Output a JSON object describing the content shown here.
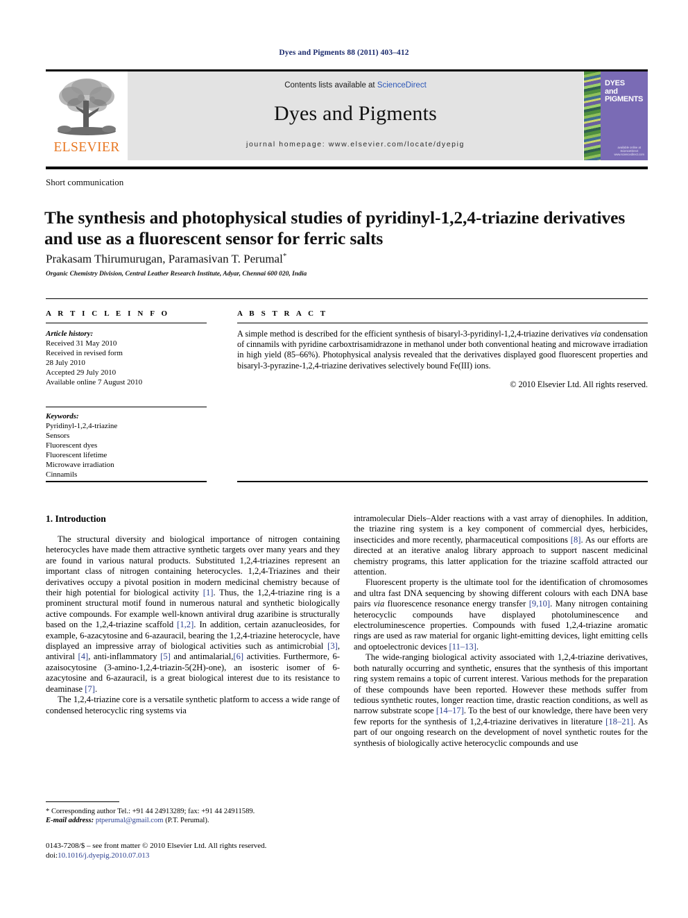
{
  "running_head": "Dyes and Pigments 88 (2011) 403–412",
  "masthead": {
    "publisher_name": "ELSEVIER",
    "contents_prefix": "Contents lists available at ",
    "contents_link": "ScienceDirect",
    "journal_name": "Dyes and Pigments",
    "homepage": "journal homepage: www.elsevier.com/locate/dyepig",
    "cover": {
      "line1": "DYES",
      "line2": "and",
      "line3": "PIGMENTS",
      "foot1": "available online at",
      "foot2": "ScienceDirect",
      "foot3": "www.sciencedirect.com"
    }
  },
  "article": {
    "section_type": "Short communication",
    "title": "The synthesis and photophysical studies of pyridinyl-1,2,4-triazine derivatives and use as a fluorescent sensor for ferric salts",
    "authors": "Prakasam Thirumurugan, Paramasivan T. Perumal",
    "author_marker": "*",
    "affiliation": "Organic Chemistry Division, Central Leather Research Institute, Adyar, Chennai 600 020, India"
  },
  "info": {
    "heading": "A R T I C L E   I N F O",
    "history_label": "Article history:",
    "history_lines": [
      "Received 31 May 2010",
      "Received in revised form",
      "28 July 2010",
      "Accepted 29 July 2010",
      "Available online 7 August 2010"
    ],
    "keywords_label": "Keywords:",
    "keywords": [
      "Pyridinyl-1,2,4-triazine",
      "Sensors",
      "Fluorescent dyes",
      "Fluorescent lifetime",
      "Microwave irradiation",
      "Cinnamils"
    ]
  },
  "abstract": {
    "heading": "A B S T R A C T",
    "body": "A simple method is described for the efficient synthesis of bisaryl-3-pyridinyl-1,2,4-triazine derivatives via condensation of cinnamils with pyridine carboxtrisamidrazone in methanol under both conventional heating and microwave irradiation in high yield (85–66%). Photophysical analysis revealed that the derivatives displayed good fluorescent properties and bisaryl-3-pyrazine-1,2,4-triazine derivatives selectively bound Fe(III) ions.",
    "copyright": "© 2010 Elsevier Ltd. All rights reserved."
  },
  "body": {
    "intro_heading": "1. Introduction",
    "left_paragraphs": [
      "The structural diversity and biological importance of nitrogen containing heterocycles have made them attractive synthetic targets over many years and they are found in various natural products. Substituted 1,2,4-triazines represent an important class of nitrogen containing heterocycles. 1,2,4-Triazines and their derivatives occupy a pivotal position in modern medicinal chemistry because of their high potential for biological activity [1]. Thus, the 1,2,4-triazine ring is a prominent structural motif found in numerous natural and synthetic biologically active compounds. For example well-known antiviral drug azaribine is structurally based on the 1,2,4-triazine scaffold [1,2]. In addition, certain azanucleosides, for example, 6-azacytosine and 6-azauracil, bearing the 1,2,4-triazine heterocycle, have displayed an impressive array of biological activities such as antimicrobial [3], antiviral [4], anti-inflammatory [5] and antimalarial,[6] activities. Furthermore, 6-azaisocytosine (3-amino-1,2,4-triazin-5(2H)-one), an isosteric isomer of 6-azacytosine and 6-azauracil, is a great biological interest due to its resistance to deaminase [7].",
      "The 1,2,4-triazine core is a versatile synthetic platform to access a wide range of condensed heterocyclic ring systems via"
    ],
    "right_paragraphs": [
      "intramolecular Diels–Alder reactions with a vast array of dienophiles. In addition, the triazine ring system is a key component of commercial dyes, herbicides, insecticides and more recently, pharmaceutical compositions [8]. As our efforts are directed at an iterative analog library approach to support nascent medicinal chemistry programs, this latter application for the triazine scaffold attracted our attention.",
      "Fluorescent property is the ultimate tool for the identification of chromosomes and ultra fast DNA sequencing by showing different colours with each DNA base pairs via fluorescence resonance energy transfer [9,10]. Many nitrogen containing heterocyclic compounds have displayed photoluminescence and electroluminescence properties. Compounds with fused 1,2,4-triazine aromatic rings are used as raw material for organic light-emitting devices, light emitting cells and optoelectronic devices [11–13].",
      "The wide-ranging biological activity associated with 1,2,4-triazine derivatives, both naturally occurring and synthetic, ensures that the synthesis of this important ring system remains a topic of current interest. Various methods for the preparation of these compounds have been reported. However these methods suffer from tedious synthetic routes, longer reaction time, drastic reaction conditions, as well as narrow substrate scope [14–17]. To the best of our knowledge, there have been very few reports for the synthesis of 1,2,4-triazine derivatives in literature [18–21]. As part of our ongoing research on the development of novel synthetic routes for the synthesis of biologically active heterocyclic compounds and use"
    ]
  },
  "footnote": {
    "line1": "* Corresponding author Tel.: +91 44 24913289; fax: +91 44 24911589.",
    "email_label": "E-mail address:",
    "email": "ptperumal@gmail.com",
    "email_suffix": "(P.T. Perumal)."
  },
  "imprint": {
    "line1": "0143-7208/$ – see front matter © 2010 Elsevier Ltd. All rights reserved.",
    "doi_label": "doi:",
    "doi_value": "10.1016/j.dyepig.2010.07.013"
  },
  "colors": {
    "running_head": "#1a2a6c",
    "elsevier_orange": "#E87722",
    "link_blue": "#2b56b8",
    "reference_blue": "#2b3f8f",
    "banner_grey": "#e3e3e3",
    "cover_purple": "#7a6bb5"
  }
}
